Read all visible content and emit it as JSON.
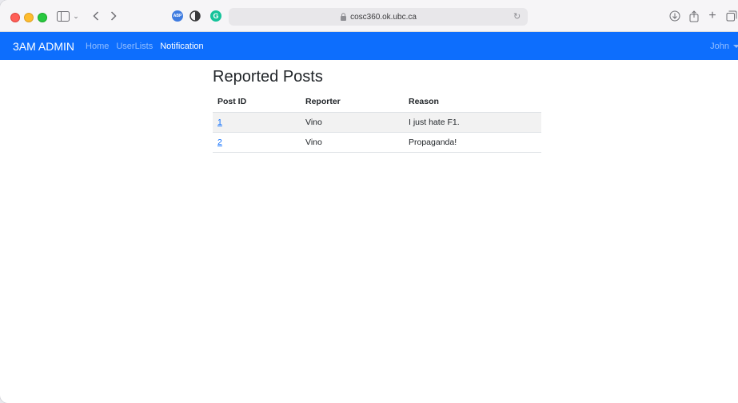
{
  "browser": {
    "url": "cosc360.ok.ubc.ca",
    "extensions": [
      "ABP",
      "G"
    ]
  },
  "navbar": {
    "brand": "3AM ADMIN",
    "links": [
      {
        "label": "Home",
        "active": false
      },
      {
        "label": "UserLists",
        "active": false
      },
      {
        "label": "Notification",
        "active": true
      }
    ],
    "user": "John"
  },
  "page": {
    "title": "Reported Posts",
    "table": {
      "headers": [
        "Post ID",
        "Reporter",
        "Reason"
      ],
      "rows": [
        {
          "post_id": "1",
          "reporter": "Vino",
          "reason": "I just hate F1."
        },
        {
          "post_id": "2",
          "reporter": "Vino",
          "reason": "Propaganda!"
        }
      ]
    }
  },
  "colors": {
    "navbar": "#0d6efd",
    "link": "#0d6efd",
    "stripe": "#f2f2f2"
  }
}
